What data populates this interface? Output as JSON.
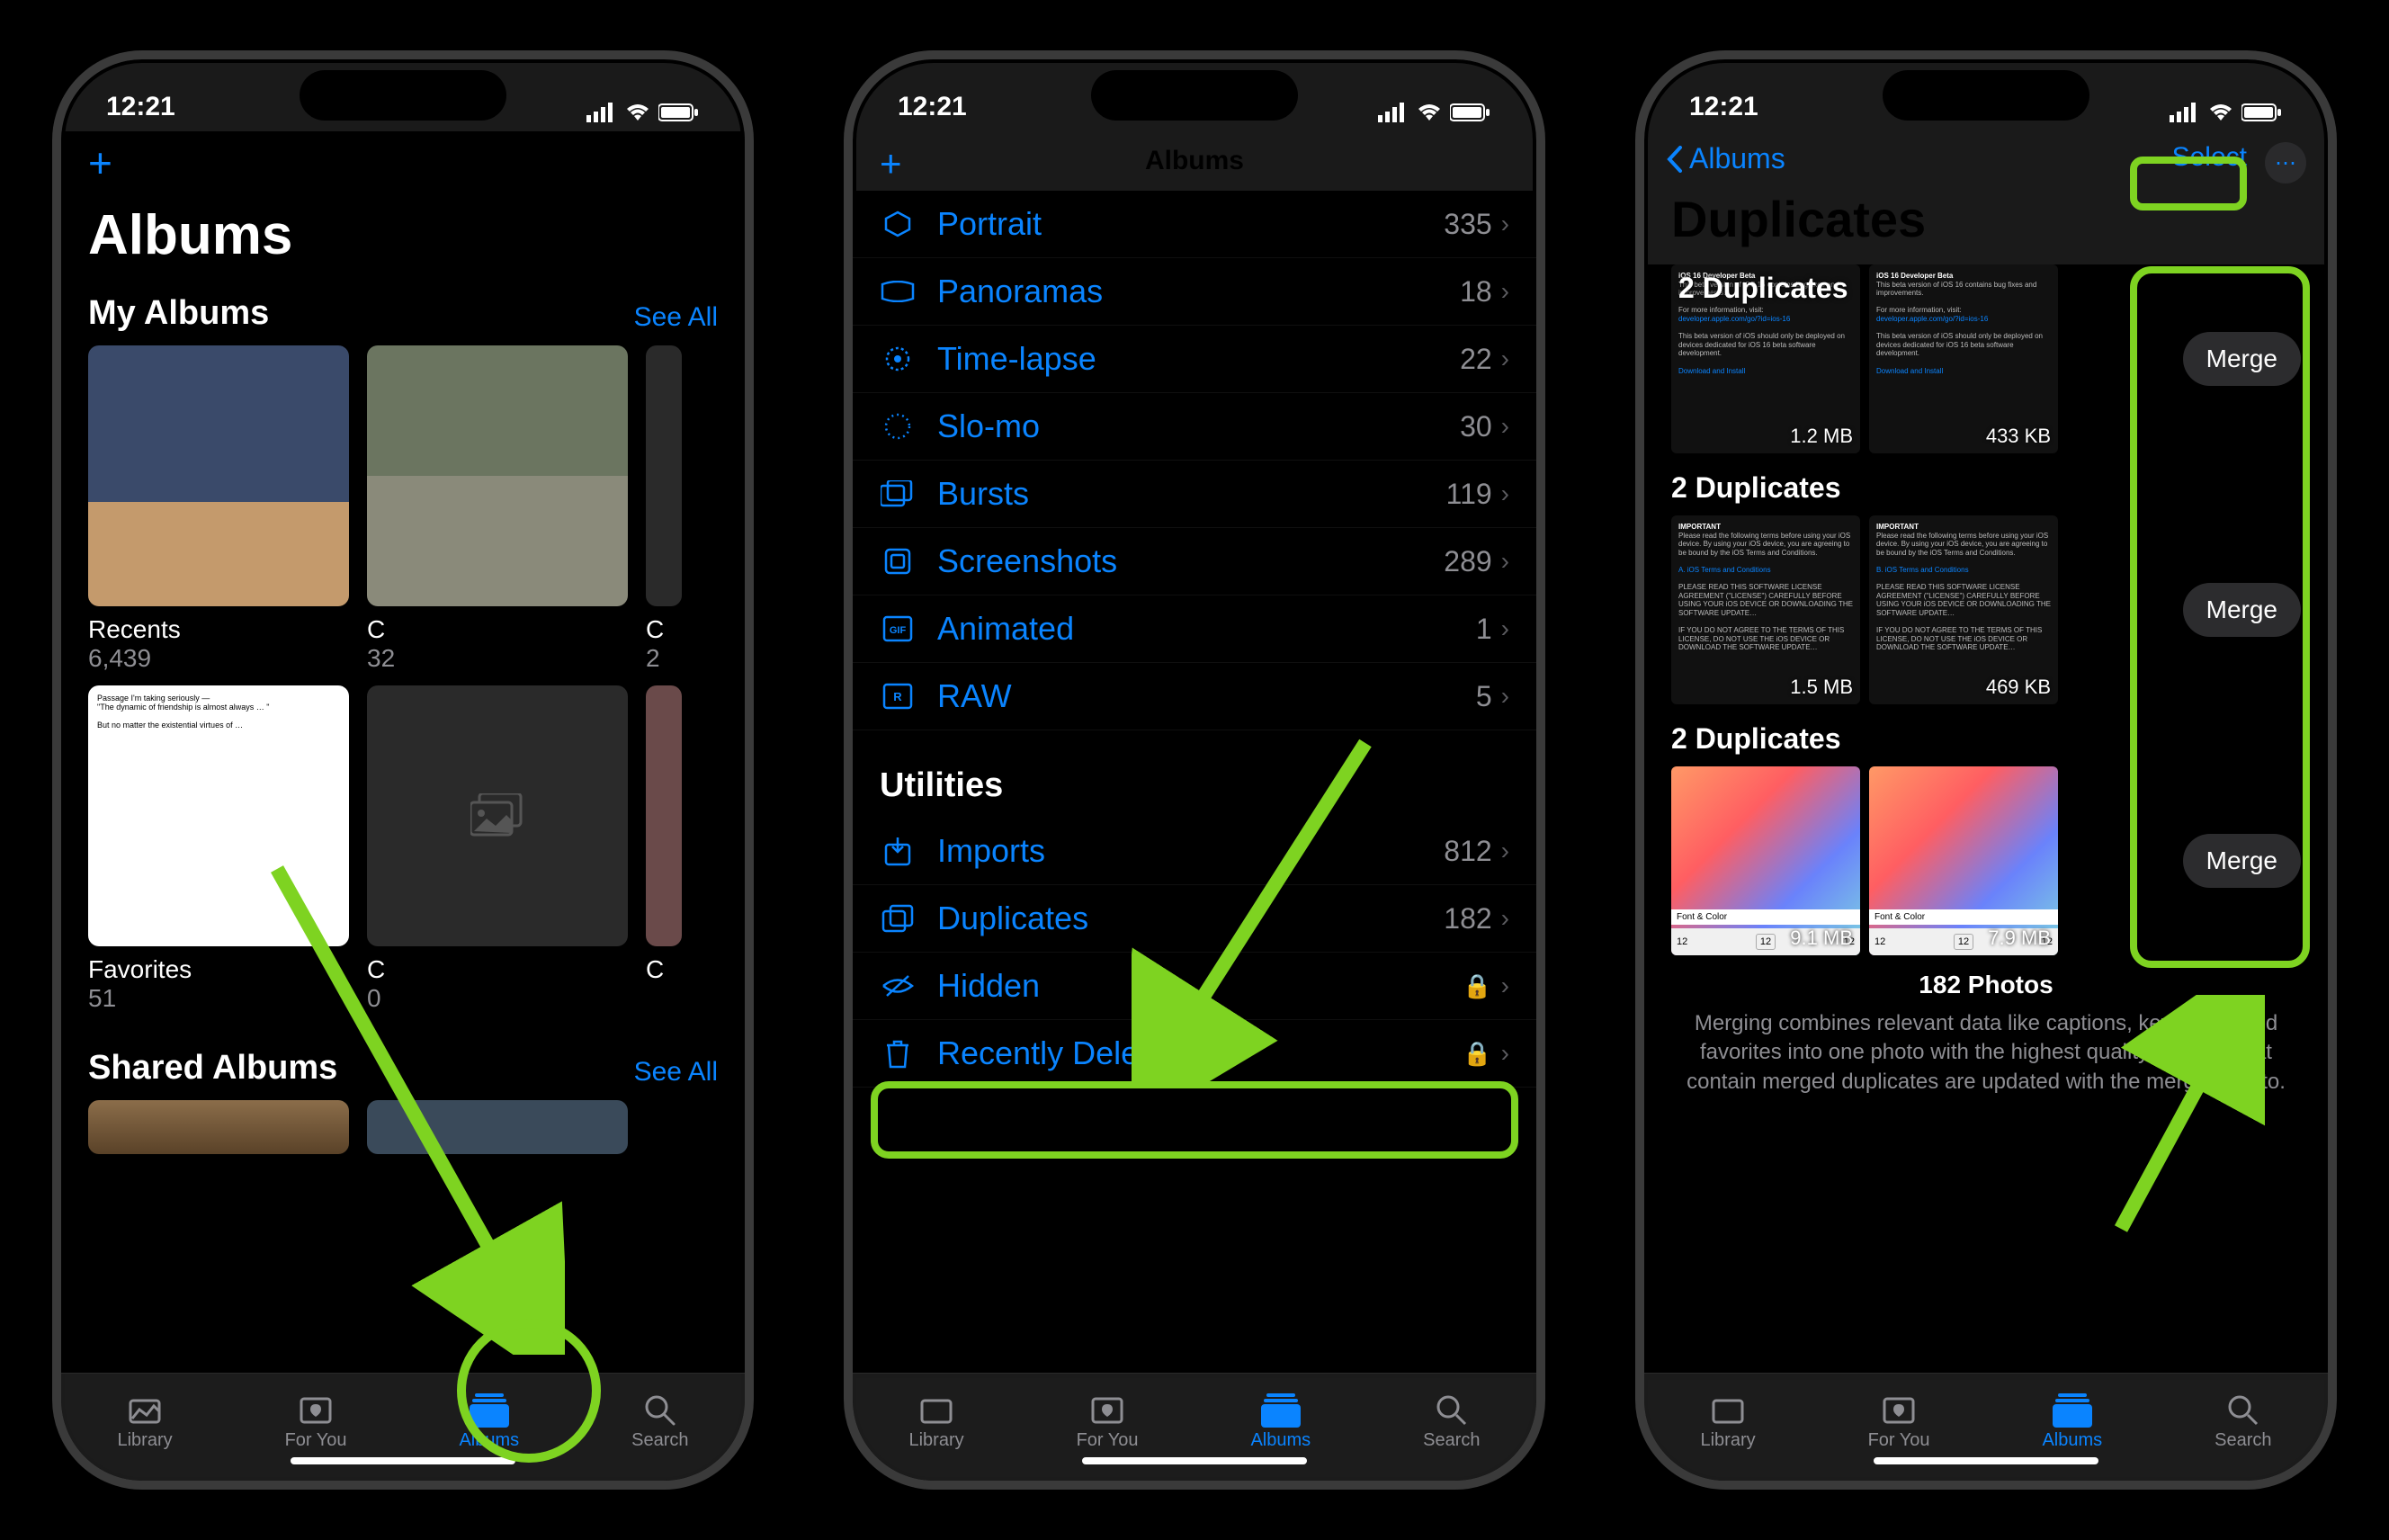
{
  "status": {
    "time": "12:21"
  },
  "tabbar": {
    "items": [
      {
        "label": "Library"
      },
      {
        "label": "For You"
      },
      {
        "label": "Albums"
      },
      {
        "label": "Search"
      }
    ]
  },
  "phone1": {
    "title": "Albums",
    "my_albums": {
      "header": "My Albums",
      "see_all": "See All",
      "items": [
        {
          "name": "Recents",
          "count": "6,439"
        },
        {
          "name_initial": "C",
          "count": "32"
        },
        {
          "name_initial": "C",
          "count": "2"
        },
        {
          "name": "Favorites",
          "count": "51"
        },
        {
          "name_initial": "C",
          "count": "0"
        },
        {
          "name_initial": "C",
          "count": ""
        }
      ]
    },
    "shared_albums": {
      "header": "Shared Albums",
      "see_all": "See All"
    }
  },
  "phone2": {
    "title": "Albums",
    "media_types": [
      {
        "label": "Portrait",
        "count": "335"
      },
      {
        "label": "Panoramas",
        "count": "18"
      },
      {
        "label": "Time-lapse",
        "count": "22"
      },
      {
        "label": "Slo-mo",
        "count": "30"
      },
      {
        "label": "Bursts",
        "count": "119"
      },
      {
        "label": "Screenshots",
        "count": "289"
      },
      {
        "label": "Animated",
        "count": "1"
      },
      {
        "label": "RAW",
        "count": "5"
      }
    ],
    "utilities_header": "Utilities",
    "utilities": [
      {
        "label": "Imports",
        "count": "812"
      },
      {
        "label": "Duplicates",
        "count": "182"
      },
      {
        "label": "Hidden",
        "locked": true
      },
      {
        "label": "Recently Deleted",
        "locked": true
      }
    ]
  },
  "phone3": {
    "back": "Albums",
    "select": "Select",
    "title": "Duplicates",
    "groups": [
      {
        "header": "2 Duplicates",
        "items": [
          {
            "size": "1.2 MB"
          },
          {
            "size": "433 KB"
          }
        ],
        "merge": "Merge"
      },
      {
        "header": "2 Duplicates",
        "items": [
          {
            "size": "1.5 MB"
          },
          {
            "size": "469 KB"
          }
        ],
        "merge": "Merge"
      },
      {
        "header": "2 Duplicates",
        "items": [
          {
            "size": "9.1 MB"
          },
          {
            "size": "7.9 MB"
          }
        ],
        "merge": "Merge"
      }
    ],
    "footer_count": "182 Photos",
    "footer_text": "Merging combines relevant data like captions, keywords, and favorites into one photo with the highest quality. Albums that contain merged duplicates are updated with the merged photo."
  }
}
